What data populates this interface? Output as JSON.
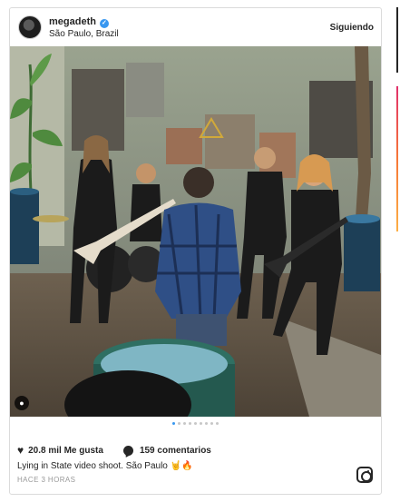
{
  "post": {
    "username": "megadeth",
    "location": "São Paulo, Brazil",
    "follow_label": "Siguiendo",
    "likes": "20.8 mil Me gusta",
    "comments": "159 comentarios",
    "caption": "Lying in State video shoot. São Paulo 🤘🔥",
    "time": "HACE 3 HORAS"
  },
  "carousel": {
    "total": 9,
    "active": 1
  },
  "icons": {
    "verified": "verified-badge-icon",
    "heart": "heart-icon",
    "comment": "comment-bubble-icon",
    "user_tag": "user-tag-icon",
    "instagram": "instagram-logo-icon"
  },
  "colors": {
    "verified": "#3897f0",
    "active_dot": "#3897f0",
    "muted": "#999999"
  }
}
